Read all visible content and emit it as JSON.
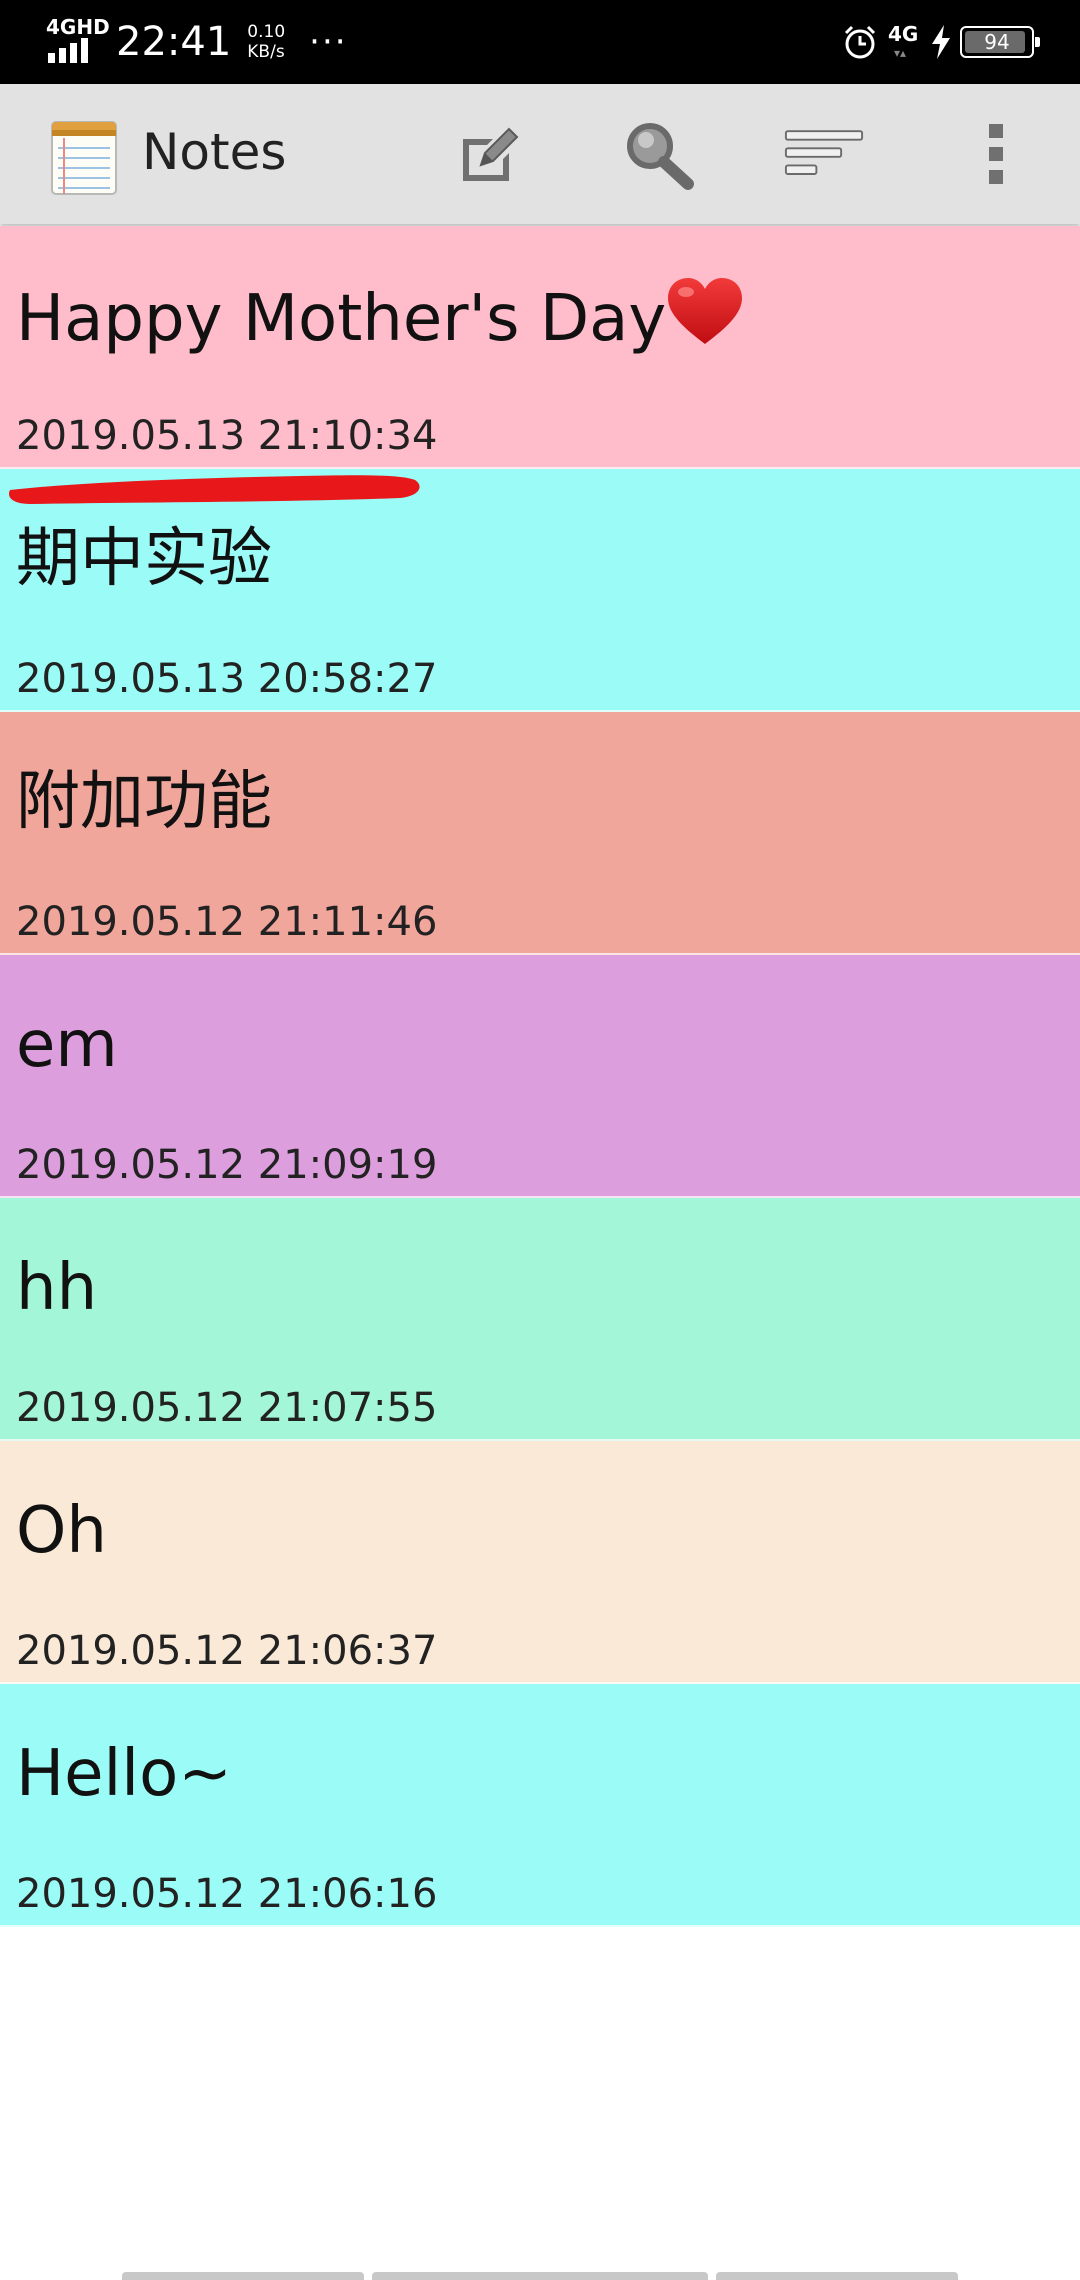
{
  "status_bar": {
    "network_left": "4GHD",
    "time": "22:41",
    "speed_value": "0.10",
    "speed_unit": "KB/s",
    "more": "···",
    "network_right": "4G",
    "battery": "94",
    "battery_level": 0.94
  },
  "app_bar": {
    "title": "Notes",
    "icons": [
      "notepad-app-icon",
      "new-note-icon",
      "search-icon",
      "sort-icon",
      "overflow-menu-icon"
    ]
  },
  "notes": [
    {
      "title": "Happy Mother's Day",
      "time": "2019.05.13 21:10:34",
      "color": "#FFBCCB",
      "emoji": "heart"
    },
    {
      "title": "期中实验",
      "time": "2019.05.13 20:58:27",
      "color": "#9BFBF6"
    },
    {
      "title": "附加功能",
      "time": "2019.05.12 21:11:46",
      "color": "#F1A69C"
    },
    {
      "title": "em",
      "time": "2019.05.12 21:09:19",
      "color": "#DC9EDC"
    },
    {
      "title": "hh",
      "time": "2019.05.12 21:07:55",
      "color": "#A4F6D9"
    },
    {
      "title": "Oh",
      "time": "2019.05.12 21:06:37",
      "color": "#F9E9D6"
    },
    {
      "title": "Hello~",
      "time": "2019.05.12 21:06:16",
      "color": "#9BFBF6"
    }
  ],
  "annotation_color": "#E8171A"
}
